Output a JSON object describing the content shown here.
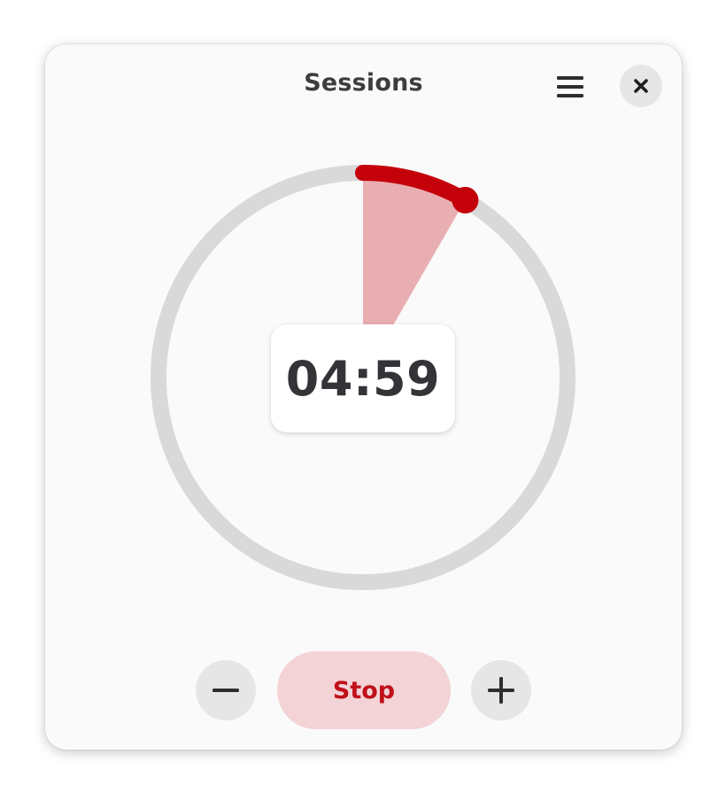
{
  "window": {
    "title": "Sessions"
  },
  "header": {
    "menu_icon": "hamburger-menu-icon",
    "close_icon": "close-icon"
  },
  "timer": {
    "display": "04:59",
    "progress_fraction": 0.0833,
    "accent_color": "#c4000a",
    "fill_color": "#e9aeb2",
    "track_color": "#d9d9d9"
  },
  "controls": {
    "decrease_icon": "minus-icon",
    "stop_label": "Stop",
    "increase_icon": "plus-icon"
  }
}
